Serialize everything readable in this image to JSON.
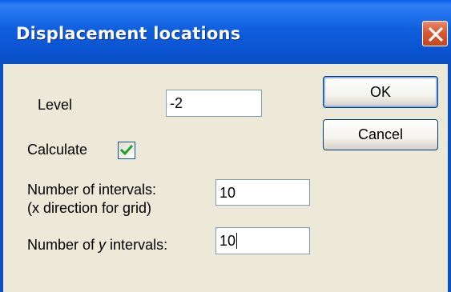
{
  "window": {
    "title": "Displacement locations"
  },
  "form": {
    "level_label": "Level",
    "level_value": "-2",
    "calculate_label": "Calculate",
    "calculate_checked": true,
    "x_intervals_label_line1": "Number of intervals:",
    "x_intervals_label_line2": "(x direction for grid)",
    "x_intervals_value": "10",
    "y_intervals_label_prefix": "Number of ",
    "y_intervals_label_italic": "y",
    "y_intervals_label_suffix": " intervals:",
    "y_intervals_value": "10"
  },
  "buttons": {
    "ok_label": "OK",
    "cancel_label": "Cancel"
  },
  "colors": {
    "titlebar": "#0A53CF",
    "dialog_bg": "#ECE9D8",
    "close_button": "#D65A32",
    "checkmark": "#21A121"
  },
  "icons": {
    "close": "close-icon",
    "check": "checkmark-icon"
  }
}
